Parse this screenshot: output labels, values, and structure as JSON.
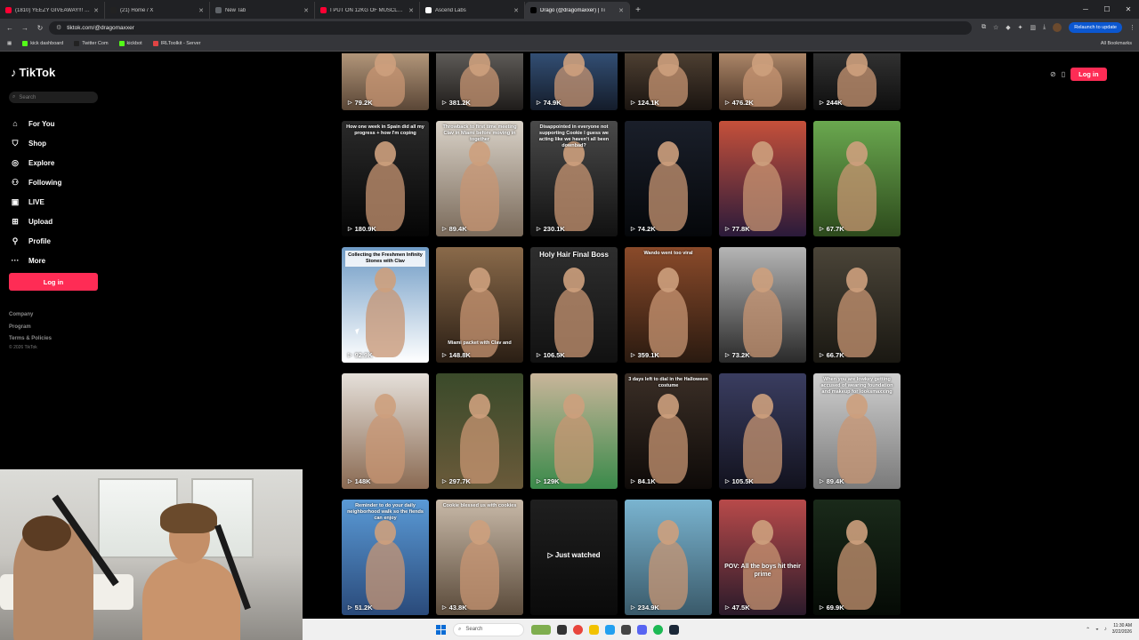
{
  "browser": {
    "tabs": [
      {
        "label": "(1810) YEEZY GIVEAWAY!!! | 67",
        "color": "#ff0033",
        "active": false
      },
      {
        "label": "(21) Home / X",
        "color": "#222222",
        "active": false
      },
      {
        "label": "New Tab",
        "color": "#5f6368",
        "active": false
      },
      {
        "label": "I PUT ON 12KG OF MUSCLE IN",
        "color": "#ff0033",
        "active": false
      },
      {
        "label": "Ascend Labs",
        "color": "#ffffff",
        "active": false
      },
      {
        "label": "Drago (@dragomaxxer) | Ti",
        "color": "#000000",
        "active": true
      }
    ],
    "url": "tiktok.com/@dragomaxxer",
    "relaunch_label": "Relaunch to update",
    "bookmarks": [
      {
        "label": "kick dashboard",
        "color": "#53fc18"
      },
      {
        "label": "Twitter Com",
        "color": "#222222"
      },
      {
        "label": "kickbot",
        "color": "#53fc18"
      },
      {
        "label": "IRLToolkit - Server",
        "color": "#e04444"
      }
    ],
    "all_bookmarks_label": "All Bookmarks"
  },
  "sidebar": {
    "logo": "TikTok",
    "search_placeholder": "Search",
    "nav": [
      {
        "label": "For You",
        "icon": "home-icon"
      },
      {
        "label": "Shop",
        "icon": "shop-icon"
      },
      {
        "label": "Explore",
        "icon": "compass-icon"
      },
      {
        "label": "Following",
        "icon": "following-icon"
      },
      {
        "label": "LIVE",
        "icon": "live-icon"
      },
      {
        "label": "Upload",
        "icon": "upload-icon"
      },
      {
        "label": "Profile",
        "icon": "profile-icon"
      },
      {
        "label": "More",
        "icon": "more-icon"
      }
    ],
    "login_label": "Log in",
    "footer_links": [
      "Company",
      "Program",
      "Terms & Policies"
    ],
    "copyright": "© 2026 TikTok"
  },
  "header": {
    "login_label": "Log in"
  },
  "videos": [
    {
      "views": "79.2K",
      "caption": ""
    },
    {
      "views": "381.2K",
      "caption": ""
    },
    {
      "views": "74.9K",
      "caption": ""
    },
    {
      "views": "124.1K",
      "caption": ""
    },
    {
      "views": "476.2K",
      "caption": ""
    },
    {
      "views": "244K",
      "caption": ""
    },
    {
      "views": "180.9K",
      "caption": "How one week in Spain did all my progress + how I'm coping"
    },
    {
      "views": "89.4K",
      "caption": "Throwback to first time meeting Clav in Miami before moving in together"
    },
    {
      "views": "230.1K",
      "caption": "Disappointed in everyone not supporting Cookie I guess we acting like we haven't all been downbad?"
    },
    {
      "views": "74.2K",
      "caption": ""
    },
    {
      "views": "77.8K",
      "caption": ""
    },
    {
      "views": "67.7K",
      "caption": ""
    },
    {
      "views": "92.9K",
      "caption": "Collecting the Freshmen Infinity Stones with Clav"
    },
    {
      "views": "148.8K",
      "caption": "Miami packet with Clav and"
    },
    {
      "views": "106.5K",
      "caption": "Holy Hair Final Boss"
    },
    {
      "views": "359.1K",
      "caption": "Wando went too viral"
    },
    {
      "views": "73.2K",
      "caption": ""
    },
    {
      "views": "66.7K",
      "caption": ""
    },
    {
      "views": "148K",
      "caption": ""
    },
    {
      "views": "297.7K",
      "caption": ""
    },
    {
      "views": "129K",
      "caption": ""
    },
    {
      "views": "84.1K",
      "caption": "3 days left to dial in the Halloween costume"
    },
    {
      "views": "105.5K",
      "caption": ""
    },
    {
      "views": "89.4K",
      "caption": "When you are lowkey getting accused of wearing foundation and makeup for looksmaxxing"
    },
    {
      "views": "51.2K",
      "caption": "Reminder to do your daily neighborhood walk so the fiends can enjoy"
    },
    {
      "views": "43.8K",
      "caption": "Cookie blessed us with cookies"
    },
    {
      "views": "Just watched",
      "caption": ""
    },
    {
      "views": "234.9K",
      "caption": ""
    },
    {
      "views": "47.5K",
      "caption": "POV: All the boys hit their prime"
    },
    {
      "views": "69.9K",
      "caption": ""
    }
  ],
  "taskbar": {
    "search_placeholder": "Search",
    "time": "11:30 AM",
    "date": "3/22/2026"
  }
}
